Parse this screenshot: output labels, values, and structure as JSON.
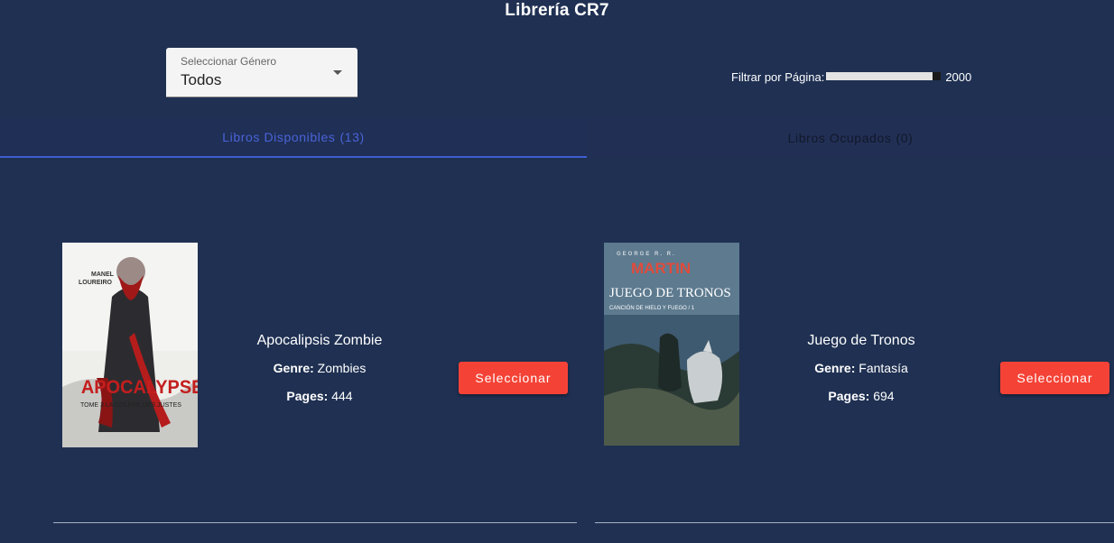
{
  "app": {
    "title": "Librería CR7"
  },
  "filters": {
    "genre_label": "Seleccionar Género",
    "genre_value": "Todos",
    "pages_label": "Filtrar por Página:",
    "pages_value": "2000"
  },
  "tabs": [
    {
      "label": "Libros Disponibles",
      "count": "(13)",
      "active": true
    },
    {
      "label": "Libros Ocupados",
      "count": "(0)",
      "active": false
    }
  ],
  "books": [
    {
      "title": "Apocalipsis Zombie",
      "genre_label": "Genre:",
      "genre": "Zombies",
      "pages_label": "Pages:",
      "pages": "444",
      "button": "Seleccionar",
      "cover": {
        "author": "MANEL LOUREIRO",
        "title": "APOCALYPSE Z",
        "subtitle": "TOME 3 LA COLÈRE DES JUSTES"
      }
    },
    {
      "title": "Juego de Tronos",
      "genre_label": "Genre:",
      "genre": "Fantasía",
      "pages_label": "Pages:",
      "pages": "694",
      "button": "Seleccionar",
      "cover": {
        "author": "GEORGE R. R. MARTIN",
        "title": "JUEGO DE TRONOS",
        "subtitle": "CANCIÓN DE HIELO Y FUEGO / 1"
      }
    }
  ],
  "colors": {
    "background": "#1f3052",
    "accent": "#3f5cd0",
    "button": "#f44336"
  }
}
